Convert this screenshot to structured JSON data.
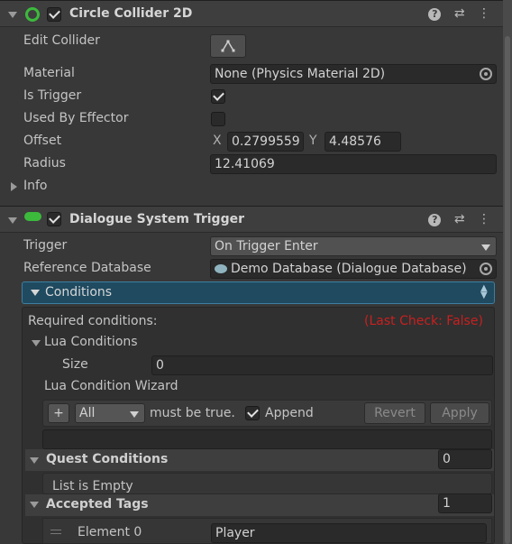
{
  "circle_collider": {
    "title": "Circle Collider 2D",
    "edit_collider_label": "Edit Collider",
    "material_label": "Material",
    "material_value": "None (Physics Material 2D)",
    "is_trigger_label": "Is Trigger",
    "is_trigger_checked": true,
    "used_by_effector_label": "Used By Effector",
    "used_by_effector_checked": false,
    "offset_label": "Offset",
    "offset_x_label": "X",
    "offset_x": "0.2799559",
    "offset_y_label": "Y",
    "offset_y": "4.48576",
    "radius_label": "Radius",
    "radius_value": "12.41069",
    "info_label": "Info"
  },
  "dialogue_trigger": {
    "title": "Dialogue System Trigger",
    "trigger_label": "Trigger",
    "trigger_value": "On Trigger Enter",
    "reference_db_label": "Reference Database",
    "reference_db_value": "Demo Database (Dialogue Database)",
    "conditions_label": "Conditions",
    "required_conditions_label": "Required conditions:",
    "last_check_label": "(Last Check: False)",
    "lua_conditions_label": "Lua Conditions",
    "size_label": "Size",
    "size_value": "0",
    "lua_wizard_label": "Lua Condition Wizard",
    "plus_label": "+",
    "all_value": "All",
    "must_be_true_label": "must be true.",
    "append_label": "Append",
    "append_checked": true,
    "revert_label": "Revert",
    "apply_label": "Apply",
    "quest_conditions_label": "Quest Conditions",
    "quest_conditions_value": "0",
    "list_empty_label": "List is Empty",
    "accepted_tags_label": "Accepted Tags",
    "accepted_tags_value": "1",
    "element0_label": "Element 0",
    "element0_value": "Player"
  },
  "colors": {
    "accent_green": "#3cba3c",
    "conditions_bar": "#1f4a60",
    "last_check_red": "#c82020"
  },
  "icons": [
    "collapse-icon",
    "enabled-circle-icon",
    "checkbox-icon",
    "help-icon",
    "presets-icon",
    "more-icon",
    "edit-collider-icon",
    "object-picker-icon",
    "database-icon",
    "dropdown-arrow-icon",
    "drag-handle-icon"
  ]
}
